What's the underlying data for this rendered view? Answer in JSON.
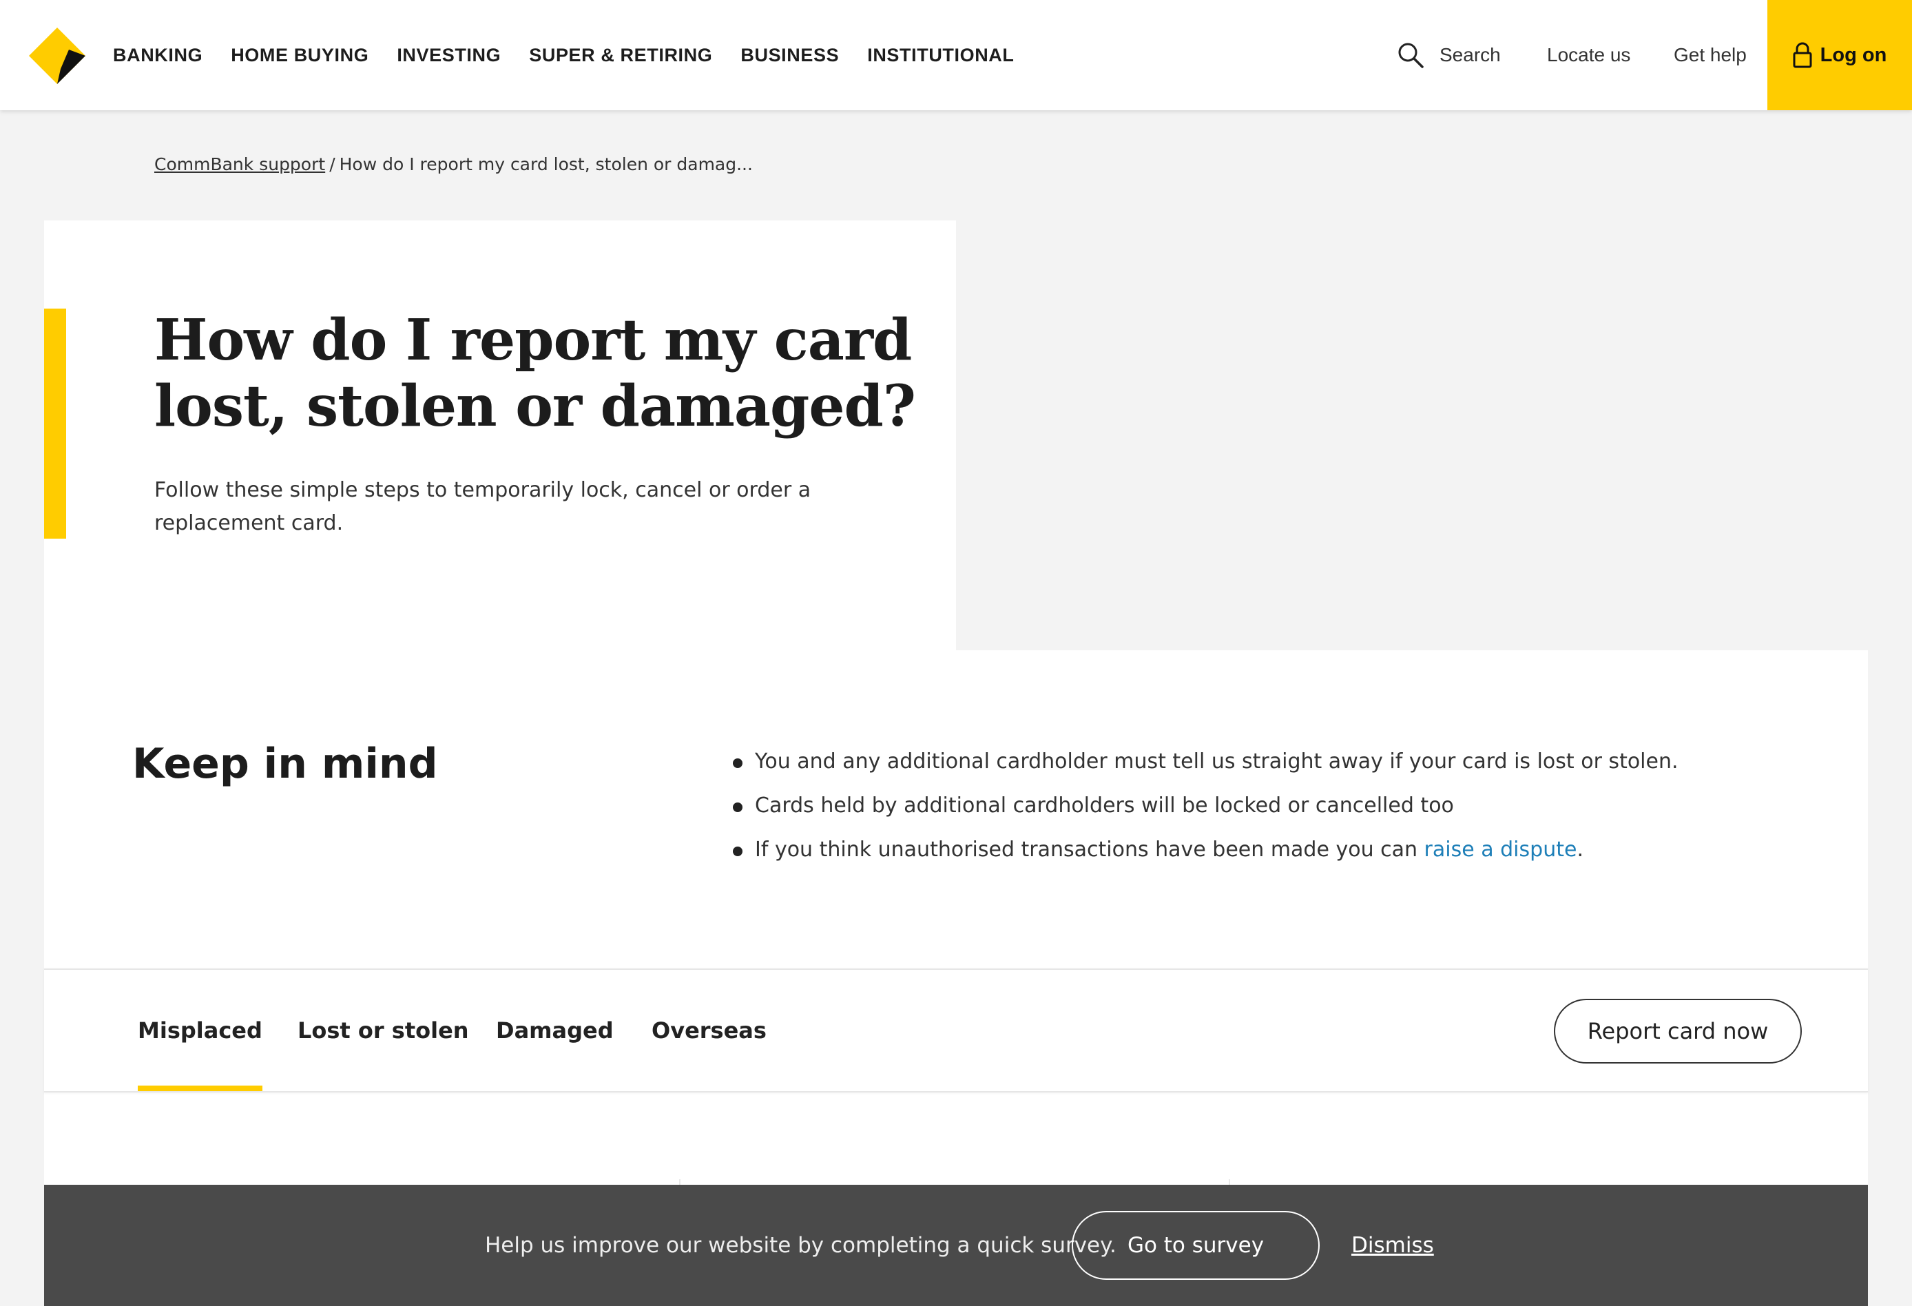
{
  "header": {
    "nav": [
      "BANKING",
      "HOME BUYING",
      "INVESTING",
      "SUPER & RETIRING",
      "BUSINESS",
      "INSTITUTIONAL"
    ],
    "search_label": "Search",
    "locate_label": "Locate us",
    "help_label": "Get help",
    "logon_label": "Log on"
  },
  "breadcrumb": {
    "root": "CommBank support",
    "separator": "/",
    "current": "How do I report my card lost, stolen or damag..."
  },
  "hero": {
    "title": "How do I report my card lost, stolen or damaged?",
    "subtitle": "Follow these simple steps to temporarily lock, cancel or order a replacement card."
  },
  "keep_in_mind": {
    "title": "Keep in mind",
    "items": [
      "You and any additional cardholder must tell us straight away if your card is lost or stolen.",
      "Cards held by additional cardholders will be locked or cancelled too"
    ],
    "dispute_prefix": "If you think unauthorised transactions have been made you can ",
    "dispute_link": "raise a dispute",
    "dispute_suffix": "."
  },
  "tabs": {
    "items": [
      "Misplaced",
      "Lost or stolen",
      "Damaged",
      "Overseas"
    ],
    "active": "Misplaced",
    "report_button": "Report card now"
  },
  "survey": {
    "text": "Help us improve our website by completing a quick survey.",
    "button": "Go to survey",
    "dismiss": "Dismiss"
  },
  "colors": {
    "brand_yellow": "#ffcc00",
    "link_blue": "#1e7fb8",
    "banner_grey": "#4a4a4a"
  },
  "icons": [
    "commbank-logo-icon",
    "search-icon",
    "lock-icon"
  ]
}
